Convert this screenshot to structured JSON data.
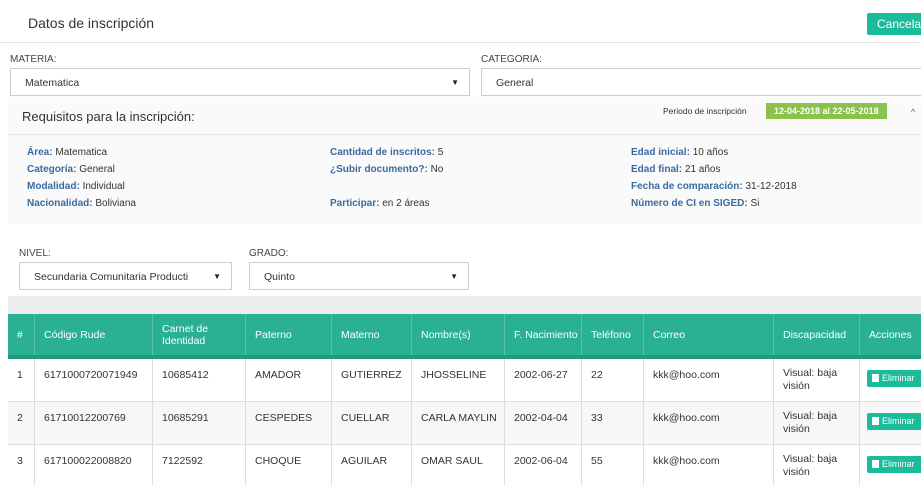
{
  "header": {
    "title": "Datos de inscripción",
    "cancel_label": "Cancela"
  },
  "filters": {
    "materia": {
      "label": "MATERIA:",
      "value": "Matematica"
    },
    "categoria": {
      "label": "CATEGORIA:",
      "value": "General"
    }
  },
  "requirements": {
    "title": "Requisitos para la inscripción:",
    "period_label": "Periodo de inscripción",
    "period_value": "12-04-2018 al 22-05-2018",
    "col1": [
      {
        "key": "Área:",
        "value": "Matematica"
      },
      {
        "key": "Categoría:",
        "value": "General"
      },
      {
        "key": "Modalidad:",
        "value": "Individual"
      },
      {
        "key": "Nacionalidad:",
        "value": "Boliviana"
      }
    ],
    "col2": [
      {
        "key": "Cantidad de inscritos:",
        "value": "5"
      },
      {
        "key": "¿Subir documento?:",
        "value": "No"
      },
      {
        "key": "Participar:",
        "value": "en 2 áreas"
      }
    ],
    "col3": [
      {
        "key": "Edad inicial:",
        "value": "10 años"
      },
      {
        "key": "Edad final:",
        "value": "21 años"
      },
      {
        "key": "Fecha de comparación:",
        "value": "31-12-2018"
      },
      {
        "key": "Número de CI en SIGED:",
        "value": "Si"
      }
    ]
  },
  "level": {
    "nivel": {
      "label": "NIVEL:",
      "value": "Secundaria Comunitaria Producti"
    },
    "grado": {
      "label": "GRADO:",
      "value": "Quinto"
    }
  },
  "table": {
    "headers": [
      "#",
      "Código Rude",
      "Carnet de Identidad",
      "Paterno",
      "Materno",
      "Nombre(s)",
      "F. Nacimiento",
      "Teléfono",
      "Correo",
      "Discapacidad",
      "Acciones"
    ],
    "delete_label": "Eliminar",
    "rows": [
      [
        "1",
        "6171000720071949",
        "10685412",
        "AMADOR",
        "GUTIERREZ",
        "JHOSSELINE",
        "2002-06-27",
        "22",
        "kkk@hoo.com",
        "Visual: baja visión"
      ],
      [
        "2",
        "61710012200769",
        "10685291",
        "CESPEDES",
        "CUELLAR",
        "CARLA MAYLIN",
        "2002-04-04",
        "33",
        "kkk@hoo.com",
        "Visual: baja visión"
      ],
      [
        "3",
        "617100022008820",
        "7122592",
        "CHOQUE",
        "AGUILAR",
        "OMAR SAUL",
        "2002-06-04",
        "55",
        "kkk@hoo.com",
        "Visual: baja visión"
      ]
    ]
  }
}
